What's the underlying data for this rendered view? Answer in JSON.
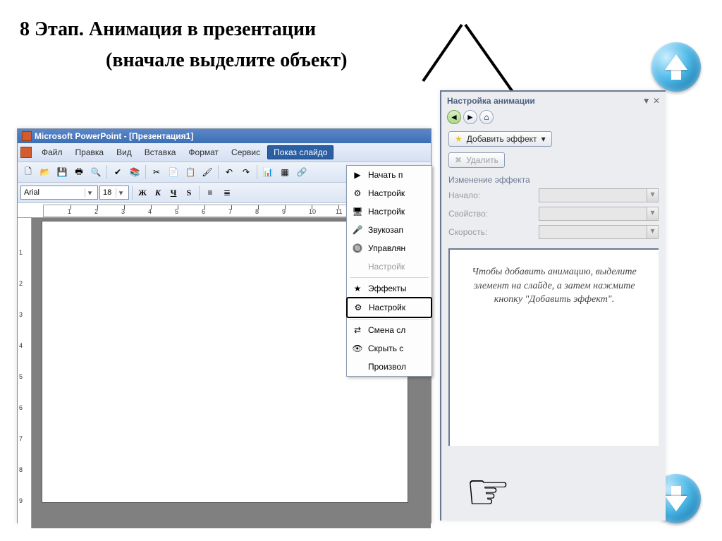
{
  "slide": {
    "title": "8 Этап. Анимация в презентации",
    "subtitle": "(вначале выделите объект)"
  },
  "pp": {
    "app_title": "Microsoft PowerPoint - [Презентация1]",
    "menu": {
      "file": "Файл",
      "edit": "Правка",
      "view": "Вид",
      "insert": "Вставка",
      "format": "Формат",
      "tools": "Сервис",
      "slideshow": "Показ слайдо"
    },
    "font": {
      "name": "Arial",
      "size": "18"
    },
    "fmt": {
      "bold": "Ж",
      "italic": "К",
      "underline": "Ч",
      "shadow": "S"
    }
  },
  "dropdown": {
    "items": [
      "Начать п",
      "Настройк",
      "Настройк",
      "Звукозап",
      "Управлян",
      "Настройк",
      "Эффекты",
      "Настройк",
      "Смена сл",
      "Скрыть с",
      "Произвол"
    ],
    "disabled_index": 5,
    "boxed_index": 7
  },
  "anim": {
    "title": "Настройка анимации",
    "add_effect": "Добавить эффект",
    "remove": "Удалить",
    "section": "Изменение эффекта",
    "fields": {
      "start": "Начало:",
      "property": "Свойство:",
      "speed": "Скорость:"
    },
    "hint": "Чтобы добавить анимацию, выделите элемент на слайде, а затем нажмите кнопку \"Добавить эффект\"."
  }
}
